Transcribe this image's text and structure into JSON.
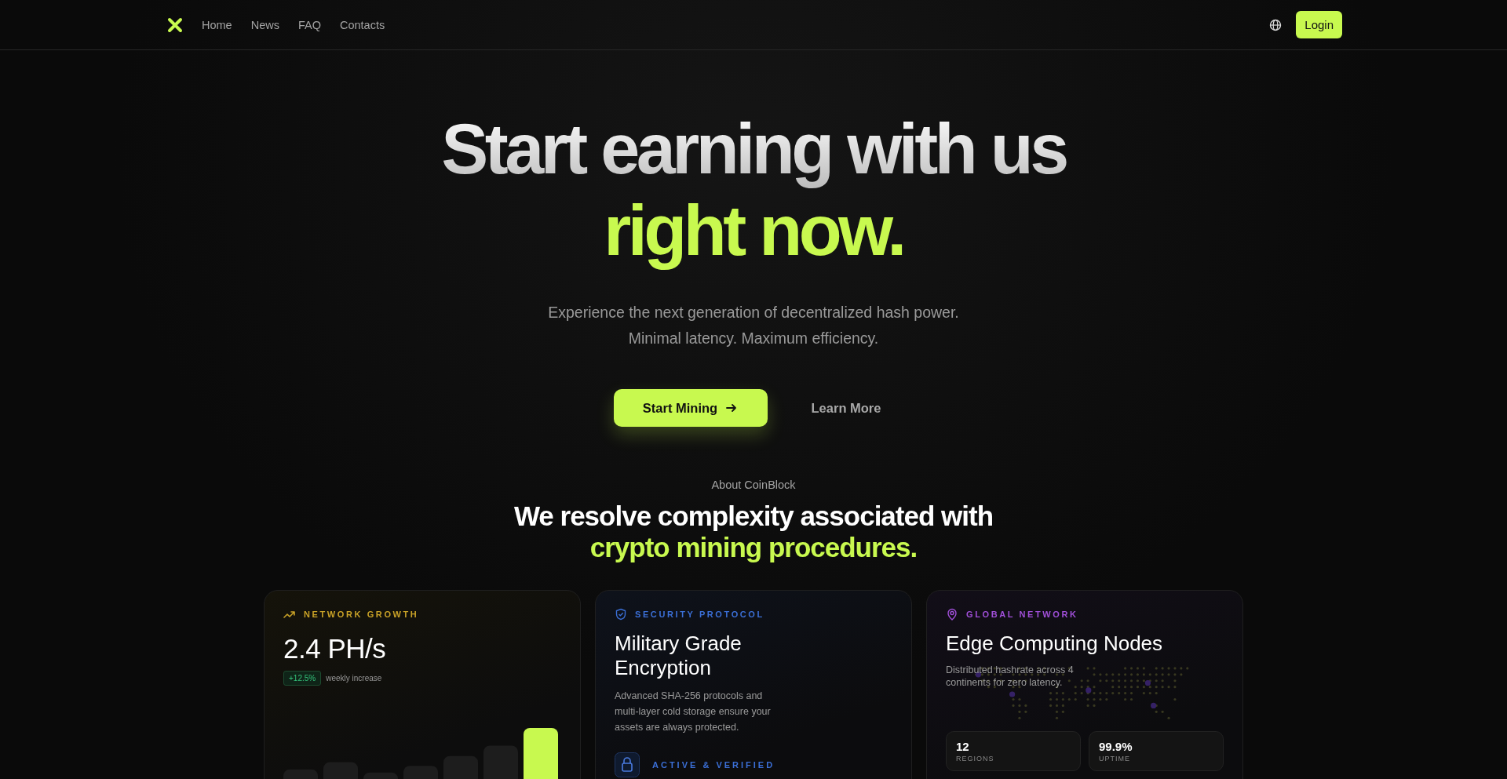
{
  "nav": {
    "links": [
      {
        "label": "Home"
      },
      {
        "label": "News"
      },
      {
        "label": "FAQ"
      },
      {
        "label": "Contacts"
      }
    ],
    "login": "Login"
  },
  "hero": {
    "title_line_1": "Start earning with us",
    "title_line_2": "right now.",
    "subtitle_lines": [
      "Experience the next generation of decentralized hash power.",
      "Minimal latency. Maximum efficiency."
    ],
    "primary_button": "Start Mining",
    "secondary_button": "Learn More"
  },
  "about": {
    "eyebrow": "About CoinBlock",
    "heading_line_1": "We resolve complexity associated with",
    "heading_line_2": "crypto mining procedures."
  },
  "cards": [
    {
      "kind": "growth",
      "label": "NETWORK GROWTH",
      "color": "#c9a227",
      "value": "2.4 PH/s",
      "badge": "+12.5%",
      "badge_note": "weekly increase"
    },
    {
      "kind": "security",
      "label": "SECURITY PROTOCOL",
      "color": "#3b6fd6",
      "title": "Military Grade Encryption",
      "description": "Advanced SHA-256 protocols and multi-layer cold storage ensure your assets are always protected.",
      "status": "ACTIVE & VERIFIED"
    },
    {
      "kind": "network",
      "label": "GLOBAL NETWORK",
      "color": "#a04fd8",
      "title": "Edge Computing Nodes",
      "description": "Distributed hashrate across 4 continents for zero latency.",
      "stats": [
        {
          "value": "12",
          "caption": "REGIONS"
        },
        {
          "value": "99.9%",
          "caption": "UPTIME"
        }
      ]
    }
  ]
}
